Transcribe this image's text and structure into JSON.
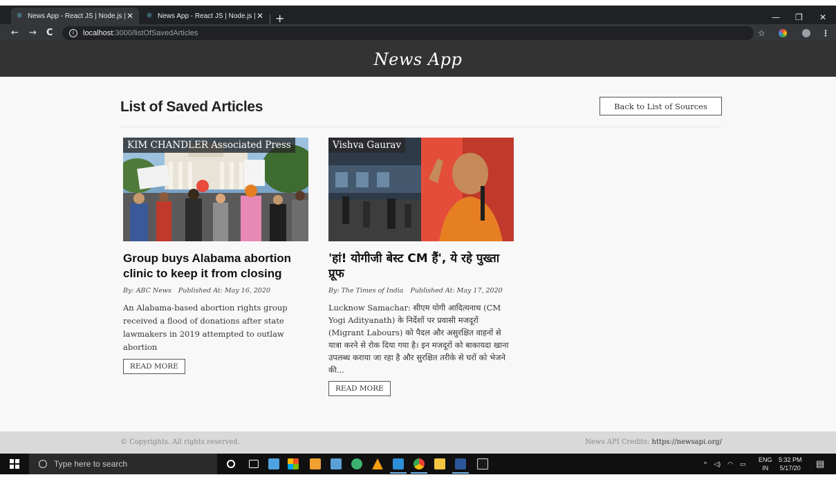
{
  "browser": {
    "tabs": [
      {
        "title": "News App - React JS | Node.js | R",
        "active": true
      },
      {
        "title": "News App - React JS | Node.js | R",
        "active": false
      }
    ],
    "url_host": "localhost",
    "url_path": ":3000/listOfSavedArticles"
  },
  "app": {
    "brand": "News App"
  },
  "page": {
    "title": "List of Saved Articles",
    "back_button": "Back to List of Sources"
  },
  "articles": [
    {
      "author": "KIM CHANDLER Associated Press",
      "headline": "Group buys Alabama abortion clinic to keep it from closing",
      "by": "By: ABC News",
      "published": "Published At: May 16, 2020",
      "description": "An Alabama-based abortion rights group received a flood of donations after state lawmakers in 2019 attempted to outlaw abortion",
      "read_more": "READ MORE"
    },
    {
      "author": "Vishva Gaurav",
      "headline": "'हां! योगीजी बेस्ट CM हैं', ये रहे पुख्ता प्रूफ",
      "by": "By: The Times of India",
      "published": "Published At: May 17, 2020",
      "description": "Lucknow Samachar: सीएम योगी आदित्यनाथ (CM Yogi Adityanath) के निर्देशों पर प्रवासी मजदूरों (Migrant Labours) को पैदल और असुरक्षित वाहनों से यात्रा करने से रोक दिया गया है। इन मजदूरों को बाकायदा खाना उपलब्ध कराया जा रहा है और सुरक्षित तरीके से घरों को भेजने की...",
      "read_more": "READ MORE"
    }
  ],
  "footer": {
    "copyright": "© Copyrights. All rights reserved.",
    "credits_label": "News API Credits:",
    "credits_link": "https://newsapi.org/"
  },
  "taskbar": {
    "search_placeholder": "Type here to search",
    "lang_top": "ENG",
    "lang_bottom": "IN",
    "time": "5:32 PM",
    "date": "5/17/20"
  }
}
